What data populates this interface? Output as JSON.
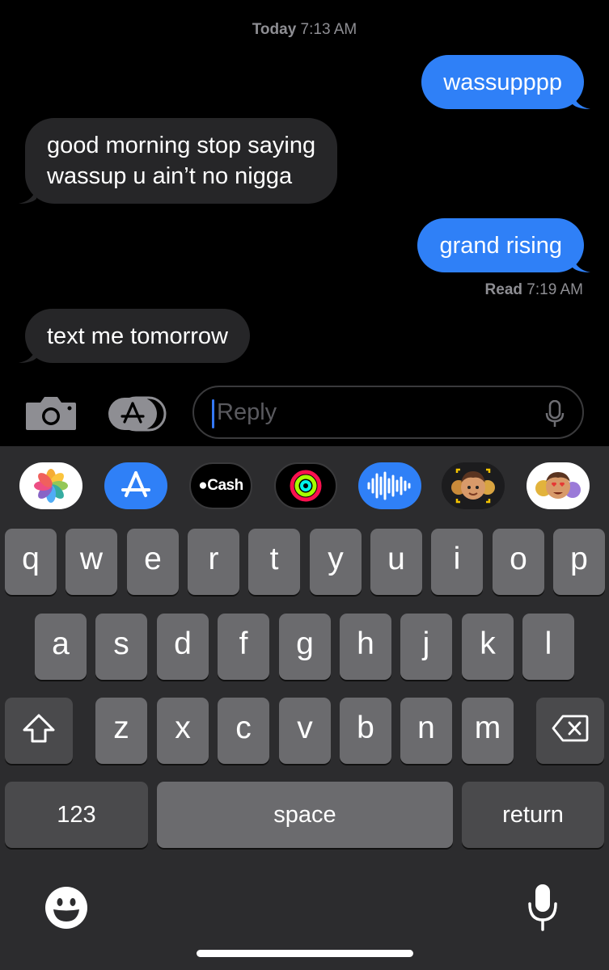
{
  "conversation": {
    "timestamp_day": "Today",
    "timestamp_time": "7:13 AM",
    "messages": [
      {
        "direction": "sent",
        "text": "wassupppp"
      },
      {
        "direction": "received",
        "line1": "good morning stop saying",
        "line2": "wassup u ain’t no nigga"
      },
      {
        "direction": "sent",
        "text": "grand rising"
      },
      {
        "direction": "received",
        "text": "text me tomorrow"
      }
    ],
    "read_label": "Read",
    "read_time": "7:19 AM"
  },
  "input_bar": {
    "placeholder": "Reply",
    "value": "",
    "icons": [
      "camera-icon",
      "app-store-icon",
      "microphone-icon"
    ]
  },
  "app_strip": {
    "apps": [
      {
        "name": "Photos",
        "icon": "photos-icon"
      },
      {
        "name": "App Store",
        "icon": "app-store-icon"
      },
      {
        "name": "Apple Cash",
        "icon": "apple-cash-icon",
        "label": "Cash"
      },
      {
        "name": "Activity",
        "icon": "activity-rings-icon"
      },
      {
        "name": "Audio Message",
        "icon": "waveform-icon"
      },
      {
        "name": "Memoji",
        "icon": "memoji-icon"
      },
      {
        "name": "Memoji Stickers",
        "icon": "memoji-stickers-icon"
      }
    ]
  },
  "keyboard": {
    "row1": [
      "q",
      "w",
      "e",
      "r",
      "t",
      "y",
      "u",
      "i",
      "o",
      "p"
    ],
    "row2": [
      "a",
      "s",
      "d",
      "f",
      "g",
      "h",
      "j",
      "k",
      "l"
    ],
    "row3": [
      "z",
      "x",
      "c",
      "v",
      "b",
      "n",
      "m"
    ],
    "numbers_label": "123",
    "space_label": "space",
    "return_label": "return",
    "shift_icon": "shift-icon",
    "delete_icon": "delete-icon",
    "emoji_icon": "emoji-icon",
    "dictation_icon": "microphone-icon"
  },
  "colors": {
    "background": "#000000",
    "sent_bubble": "#2f80f7",
    "received_bubble": "#262628",
    "keyboard_bg": "#2c2c2e",
    "key": "#6b6b6e",
    "key_dark": "#4a4a4c",
    "meta_text": "#8e8e93",
    "caret": "#3478f6"
  }
}
